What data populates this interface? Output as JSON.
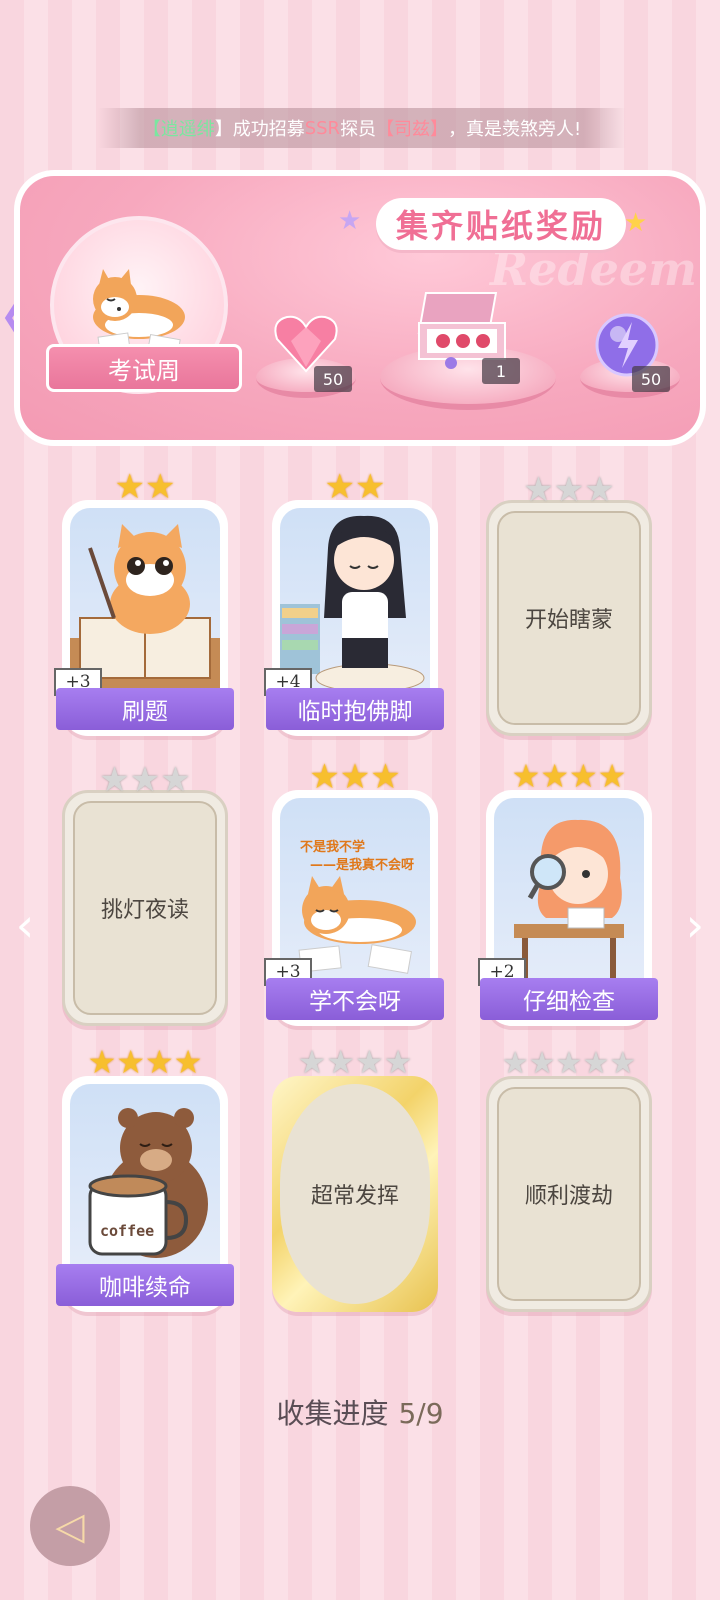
{
  "ticker": {
    "prefix": "【",
    "player": "逍遥绯",
    "mid1": "】成功招募",
    "rank": "SSR",
    "mid2": "探员",
    "agent": "【司兹】",
    "suffix": "，真是羡煞旁人!"
  },
  "reward_panel": {
    "title": "集齐贴纸奖励",
    "watermark": "Redeem",
    "current_set": "考试周",
    "rewards": [
      {
        "icon": "heart-gem-icon",
        "count": "50"
      },
      {
        "icon": "gift-box-icon",
        "count": "1"
      },
      {
        "icon": "energy-orb-icon",
        "count": "50"
      }
    ]
  },
  "cards": [
    {
      "name": "刷题",
      "stars_on": 2,
      "stars_total": 2,
      "bonus": "+3",
      "state": "collected",
      "art": "cat-studying"
    },
    {
      "name": "临时抱佛脚",
      "stars_on": 2,
      "stars_total": 2,
      "bonus": "+4",
      "state": "collected",
      "art": "girl-praying"
    },
    {
      "name": "开始瞎蒙",
      "stars_on": 0,
      "stars_total": 3,
      "bonus": "",
      "state": "locked"
    },
    {
      "name": "挑灯夜读",
      "stars_on": 0,
      "stars_total": 3,
      "bonus": "",
      "state": "locked"
    },
    {
      "name": "学不会呀",
      "stars_on": 3,
      "stars_total": 3,
      "bonus": "+3",
      "state": "collected",
      "art": "shiba-lying",
      "art_text1": "不是我不学",
      "art_text2": "——是我真不会呀"
    },
    {
      "name": "仔细检查",
      "stars_on": 4,
      "stars_total": 4,
      "bonus": "+2",
      "state": "collected",
      "art": "girl-magnifier"
    },
    {
      "name": "咖啡续命",
      "stars_on": 4,
      "stars_total": 4,
      "bonus": "",
      "state": "collected",
      "art": "bear-coffee",
      "art_text1": "coffee"
    },
    {
      "name": "超常发挥",
      "stars_on": 0,
      "stars_total": 4,
      "bonus": "",
      "state": "gold-locked"
    },
    {
      "name": "顺利渡劫",
      "stars_on": 0,
      "stars_total": 5,
      "bonus": "",
      "state": "locked"
    }
  ],
  "progress": {
    "label": "收集进度",
    "value": "5/9"
  },
  "colors": {
    "accent_pink": "#f06f95",
    "name_bar_purple": "#8a5ed8",
    "star_gold": "#f7bf2e"
  }
}
